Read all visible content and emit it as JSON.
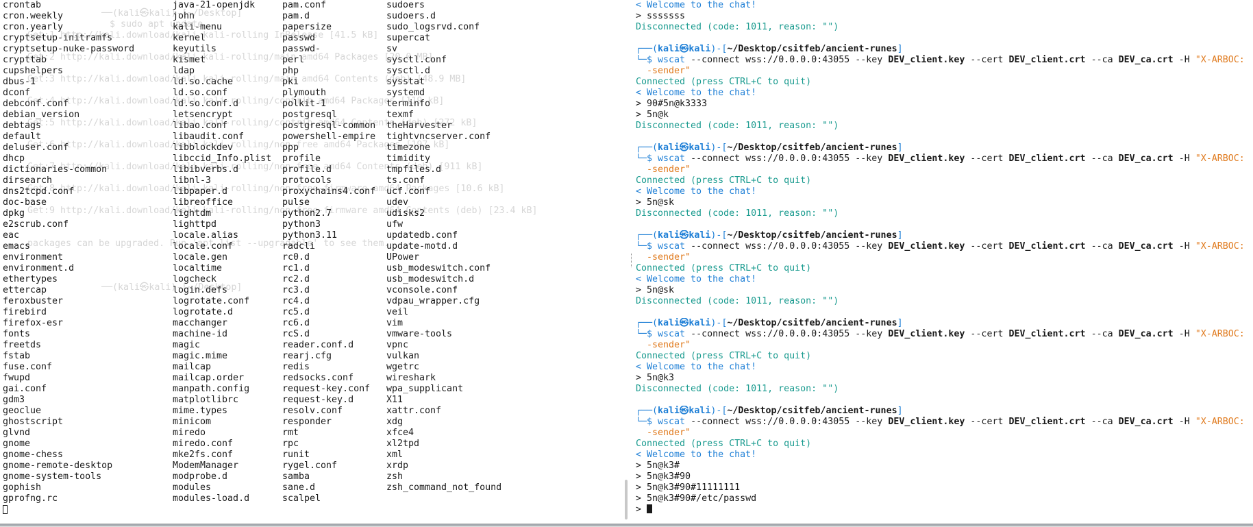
{
  "left_pane": {
    "columns": [
      [
        "crontab",
        "cron.weekly",
        "cron.yearly",
        "cryptsetup-initramfs",
        "cryptsetup-nuke-password",
        "crypttab",
        "cupshelpers",
        "dbus-1",
        "dconf",
        "debconf.conf",
        "debian_version",
        "debtags",
        "default",
        "deluser.conf",
        "dhcp",
        "dictionaries-common",
        "dirsearch",
        "dns2tcpd.conf",
        "doc-base",
        "dpkg",
        "e2scrub.conf",
        "eac",
        "emacs",
        "environment",
        "environment.d",
        "ethertypes",
        "ettercap",
        "feroxbuster",
        "firebird",
        "firefox-esr",
        "fonts",
        "freetds",
        "fstab",
        "fuse.conf",
        "fwupd",
        "gai.conf",
        "gdm3",
        "geoclue",
        "ghostscript",
        "glvnd",
        "gnome",
        "gnome-chess",
        "gnome-remote-desktop",
        "gnome-system-tools",
        "gophish",
        "gprofng.rc"
      ],
      [
        "java-21-openjdk",
        "john",
        "kali-menu",
        "kernel",
        "keyutils",
        "kismet",
        "ldap",
        "ld.so.cache",
        "ld.so.conf",
        "ld.so.conf.d",
        "letsencrypt",
        "libao.conf",
        "libaudit.conf",
        "libblockdev",
        "libccid_Info.plist",
        "libibverbs.d",
        "libnl-3",
        "libpaper.d",
        "libreoffice",
        "lightdm",
        "lighttpd",
        "locale.alias",
        "locale.conf",
        "locale.gen",
        "localtime",
        "logcheck",
        "login.defs",
        "logrotate.conf",
        "logrotate.d",
        "macchanger",
        "machine-id",
        "magic",
        "magic.mime",
        "mailcap",
        "mailcap.order",
        "manpath.config",
        "matplotlibrc",
        "mime.types",
        "minicom",
        "miredo",
        "miredo.conf",
        "mke2fs.conf",
        "ModemManager",
        "modprobe.d",
        "modules",
        "modules-load.d"
      ],
      [
        "pam.conf",
        "pam.d",
        "papersize",
        "passwd",
        "passwd-",
        "perl",
        "php",
        "pki",
        "plymouth",
        "polkit-1",
        "postgresql",
        "postgresql-common",
        "powershell-empire",
        "ppp",
        "profile",
        "profile.d",
        "protocols",
        "proxychains4.conf",
        "pulse",
        "python2.7",
        "python3",
        "python3.11",
        "radcli",
        "rc0.d",
        "rc1.d",
        "rc2.d",
        "rc3.d",
        "rc4.d",
        "rc5.d",
        "rc6.d",
        "rcS.d",
        "reader.conf.d",
        "rearj.cfg",
        "redis",
        "redsocks.conf",
        "request-key.conf",
        "request-key.d",
        "resolv.conf",
        "responder",
        "rmt",
        "rpc",
        "runit",
        "rygel.conf",
        "samba",
        "sane.d",
        "scalpel"
      ],
      [
        "sudoers",
        "sudoers.d",
        "sudo_logsrvd.conf",
        "supercat",
        "sv",
        "sysctl.conf",
        "sysctl.d",
        "sysstat",
        "systemd",
        "terminfo",
        "texmf",
        "theHarvester",
        "tightvncserver.conf",
        "timezone",
        "timidity",
        "tmpfiles.d",
        "ts.conf",
        "ucf.conf",
        "udev",
        "udisks2",
        "ufw",
        "updatedb.conf",
        "update-motd.d",
        "UPower",
        "usb_modeswitch.conf",
        "usb_modeswitch.d",
        "vconsole.conf",
        "vdpau_wrapper.cfg",
        "veil",
        "vim",
        "vmware-tools",
        "vpnc",
        "vulkan",
        "wgetrc",
        "wireshark",
        "wpa_supplicant",
        "X11",
        "xattr.conf",
        "xdg",
        "xfce4",
        "xl2tpd",
        "xml",
        "xrdp",
        "zsh",
        "zsh_command_not_found"
      ]
    ]
  },
  "right_pane": {
    "top_lines": {
      "welcome": "< Welcome to the chat!",
      "input": "> sssssss",
      "disconnected": "Disconnected (code: 1011, reason: \"\")"
    },
    "prompt": {
      "box_open": "┌──(",
      "user": "kali㉿kali",
      "mid": ")-[",
      "path": "~/Desktop/csitfeb/ancient-runes",
      "close": "]",
      "box_cmd": "└─$ "
    },
    "command": {
      "cmd": "wscat",
      "connect_opt": "--connect",
      "url": "wss://0.0.0.0:43055",
      "key_opt": "--key",
      "key_val": "DEV_client.key",
      "cert_opt": "--cert",
      "cert_val": "DEV_client.crt",
      "ca_opt": "--ca",
      "ca_val": "DEV_ca.crt",
      "h_opt": "-H",
      "h_val": "\"X-ARBOC:",
      "h_cont": "-sender\""
    },
    "connected": "Connected (press CTRL+C to quit)",
    "welcome": "< Welcome to the chat!",
    "disconnected": "Disconnected (code: 1011, reason: \"\")",
    "sessions": [
      {
        "inputs": [
          "> 90#5n@k3333",
          "> 5n@k"
        ]
      },
      {
        "inputs": [
          "> 5n@sk"
        ]
      },
      {
        "inputs": [
          "> 5n@sk"
        ]
      },
      {
        "inputs": [
          "> 5n@k3"
        ]
      }
    ],
    "final_inputs": [
      "> 5n@k3#",
      "> 5n@k3#90",
      "> 5n@k3#90#11111111",
      "> 5n@k3#90#/etc/passwd"
    ],
    "final_prompt": "> "
  }
}
